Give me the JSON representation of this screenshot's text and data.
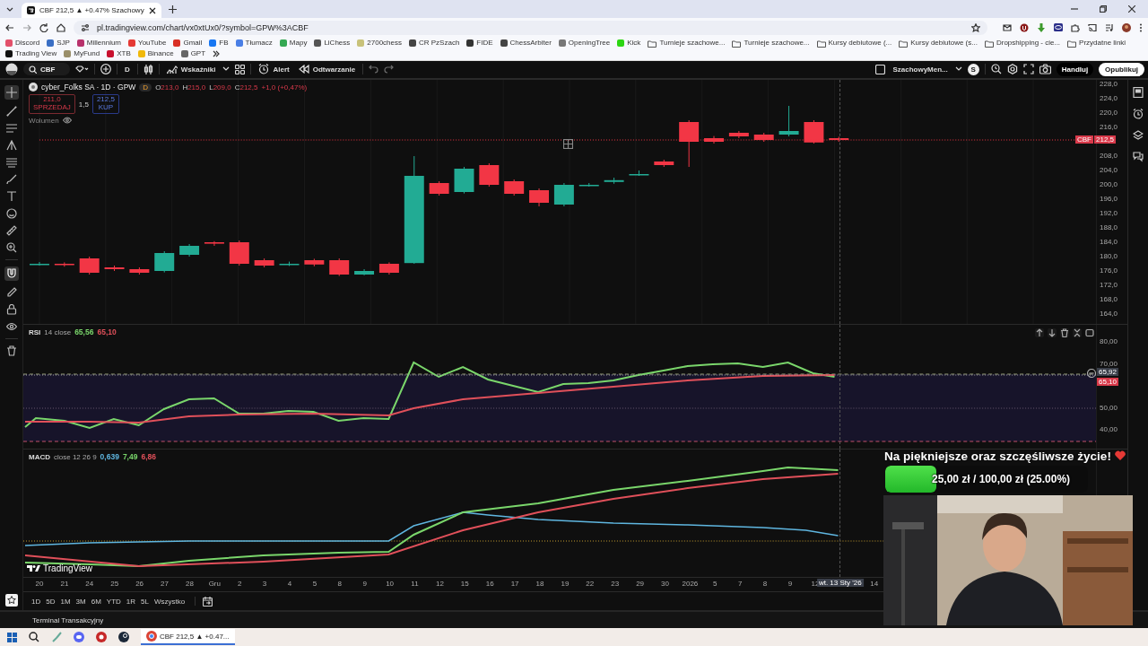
{
  "browser": {
    "tab": {
      "title": "CBF 212,5 ▲ +0.47% Szachowy"
    },
    "url": "pl.tradingview.com/chart/vx0xtUx0/?symbol=GPW%3ACBF",
    "bookmarks": [
      {
        "label": "Discord",
        "kind": "site",
        "color": "#e2506a"
      },
      {
        "label": "SJP",
        "kind": "site",
        "color": "#3a6fc4"
      },
      {
        "label": "Millennium",
        "kind": "site",
        "color": "#b8326c"
      },
      {
        "label": "YouTube",
        "kind": "site",
        "color": "#e53935"
      },
      {
        "label": "Gmail",
        "kind": "site",
        "color": "#d93025"
      },
      {
        "label": "FB",
        "kind": "site",
        "color": "#1877f2"
      },
      {
        "label": "Tłumacz",
        "kind": "site",
        "color": "#4a7fe6"
      },
      {
        "label": "Mapy",
        "kind": "site",
        "color": "#34a853"
      },
      {
        "label": "LiChess",
        "kind": "site",
        "color": "#555555"
      },
      {
        "label": "2700chess",
        "kind": "site",
        "color": "#c8c27a"
      },
      {
        "label": "CR PzSzach",
        "kind": "site",
        "color": "#444444"
      },
      {
        "label": "FIDE",
        "kind": "site",
        "color": "#333333"
      },
      {
        "label": "ChessArbiter",
        "kind": "site",
        "color": "#444444"
      },
      {
        "label": "OpeningTree",
        "kind": "site",
        "color": "#777777"
      },
      {
        "label": "Kick",
        "kind": "site",
        "color": "#2cd612"
      },
      {
        "label": "Turnieje szachowe...",
        "kind": "folder"
      },
      {
        "label": "Turnieje szachowe...",
        "kind": "folder"
      },
      {
        "label": "Kursy debiutowe (...",
        "kind": "folder"
      },
      {
        "label": "Kursy debiutowe (s...",
        "kind": "folder"
      },
      {
        "label": "Dropshipping - cie...",
        "kind": "folder"
      },
      {
        "label": "Przydatne linki",
        "kind": "folder"
      },
      {
        "label": "Trading View",
        "kind": "site",
        "color": "#111111"
      },
      {
        "label": "MyFund",
        "kind": "site",
        "color": "#9a8f6a"
      },
      {
        "label": "XTB",
        "kind": "site",
        "color": "#c8102e"
      },
      {
        "label": "Binance",
        "kind": "site",
        "color": "#f0b90b"
      },
      {
        "label": "GPT",
        "kind": "site",
        "color": "#666666"
      }
    ]
  },
  "toolbar": {
    "symbol": "CBF",
    "interval": "D",
    "indicators": "Wskaźniki",
    "alert": "Alert",
    "replay": "Odtwarzanie",
    "layout": "SzachowyMen...",
    "avatar": "S",
    "trade": "Handluj",
    "publish": "Opublikuj"
  },
  "legend": {
    "name": "cyber_Folks SA · 1D · GPW",
    "badge": "D",
    "ohlc": [
      {
        "key": "O",
        "value": "213,0"
      },
      {
        "key": "H",
        "value": "215,0"
      },
      {
        "key": "L",
        "value": "209,0"
      },
      {
        "key": "C",
        "value": "212,5"
      }
    ],
    "change": "+1,0 (+0,47%)",
    "sell": {
      "price": "211,0",
      "label": "SPRZEDAJ"
    },
    "spread": "1,5",
    "buy": {
      "price": "212,5",
      "label": "KUP"
    },
    "volume": "Wolumen"
  },
  "price_axis": [
    "228,0",
    "224,0",
    "220,0",
    "216,0",
    "208,0",
    "204,0",
    "200,0",
    "196,0",
    "192,0",
    "188,0",
    "184,0",
    "180,0",
    "176,0",
    "172,0",
    "168,0",
    "164,0"
  ],
  "price_tag": {
    "symbol": "CBF",
    "price": "212,5"
  },
  "rsi": {
    "name": "RSI",
    "params": "14 close",
    "values": [
      {
        "text": "65,56",
        "color": "#7ad66b"
      },
      {
        "text": "65,10",
        "color": "#e0505a"
      }
    ],
    "axis": [
      "80,00",
      "70,00",
      "50,00",
      "40,00"
    ],
    "cursor_value": "65,92",
    "tag": "65,10"
  },
  "macd": {
    "name": "MACD",
    "params": "close 12 26 9",
    "values": [
      {
        "text": "0,639",
        "color": "#5fb6e0"
      },
      {
        "text": "7,49",
        "color": "#7ad66b"
      },
      {
        "text": "6,86",
        "color": "#e0505a"
      }
    ]
  },
  "logo": "TradingView",
  "time_axis": [
    {
      "text": "20",
      "kind": "tick"
    },
    {
      "text": "21",
      "kind": "tick"
    },
    {
      "text": "24",
      "kind": "tick"
    },
    {
      "text": "25",
      "kind": "tick"
    },
    {
      "text": "26",
      "kind": "tick"
    },
    {
      "text": "27",
      "kind": "tick"
    },
    {
      "text": "28",
      "kind": "tick"
    },
    {
      "text": "Gru",
      "kind": "tick"
    },
    {
      "text": "2",
      "kind": "tick"
    },
    {
      "text": "3",
      "kind": "tick"
    },
    {
      "text": "4",
      "kind": "tick"
    },
    {
      "text": "5",
      "kind": "tick"
    },
    {
      "text": "8",
      "kind": "tick"
    },
    {
      "text": "9",
      "kind": "tick"
    },
    {
      "text": "10",
      "kind": "tick"
    },
    {
      "text": "11",
      "kind": "tick"
    },
    {
      "text": "12",
      "kind": "tick"
    },
    {
      "text": "15",
      "kind": "tick"
    },
    {
      "text": "16",
      "kind": "tick"
    },
    {
      "text": "17",
      "kind": "tick"
    },
    {
      "text": "18",
      "kind": "tick"
    },
    {
      "text": "19",
      "kind": "tick"
    },
    {
      "text": "22",
      "kind": "tick"
    },
    {
      "text": "23",
      "kind": "tick"
    },
    {
      "text": "29",
      "kind": "tick"
    },
    {
      "text": "30",
      "kind": "tick"
    },
    {
      "text": "2026",
      "kind": "tick"
    },
    {
      "text": "5",
      "kind": "tick"
    },
    {
      "text": "7",
      "kind": "tick"
    },
    {
      "text": "8",
      "kind": "tick"
    },
    {
      "text": "9",
      "kind": "tick"
    },
    {
      "text": "12",
      "kind": "tick"
    },
    {
      "text": "wt. 13 Sty '26",
      "kind": "cursor"
    },
    {
      "text": "14",
      "kind": "tick"
    }
  ],
  "ranges": [
    "1D",
    "5D",
    "1M",
    "3M",
    "6M",
    "YTD",
    "1R",
    "5L",
    "Wszystko"
  ],
  "terminal": "Terminal Transakcyjny",
  "taskbar": {
    "window": "CBF 212,5 ▲ +0.47..."
  },
  "overlay": {
    "goal_title": "Na piękniejsze oraz szczęśliwsze życie!",
    "goal_text": "25,00 zł / 100,00 zł (25.00%)",
    "level": 0.25
  }
}
